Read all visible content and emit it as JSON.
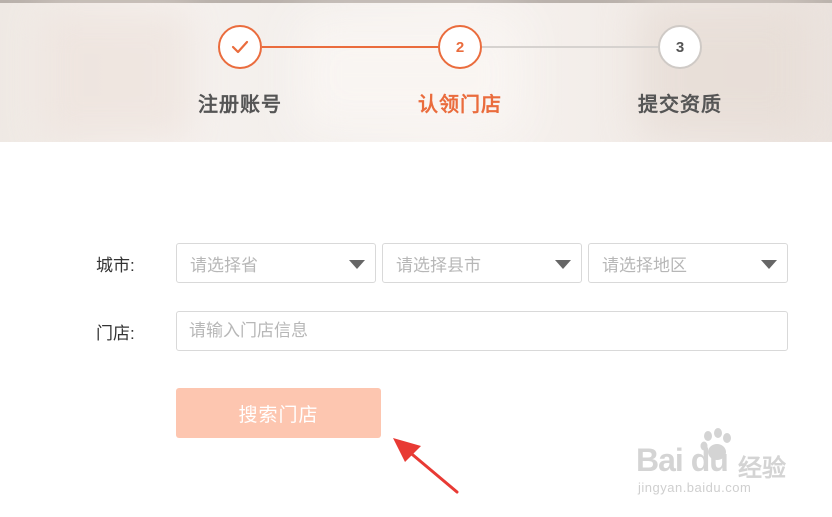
{
  "steps": [
    {
      "number": "",
      "label": "注册账号",
      "state": "done"
    },
    {
      "number": "2",
      "label": "认领门店",
      "state": "active"
    },
    {
      "number": "3",
      "label": "提交资质",
      "state": "pending"
    }
  ],
  "form": {
    "city_label": "城市:",
    "province_placeholder": "请选择省",
    "city_placeholder": "请选择县市",
    "district_placeholder": "请选择地区",
    "store_label": "门店:",
    "store_placeholder": "请输入门店信息",
    "search_label": "搜索门店"
  },
  "watermark": {
    "logo": "Bai du",
    "suffix": "经验",
    "url": "jingyan.baidu.com"
  },
  "colors": {
    "accent": "#ea6c3d",
    "button": "#fdc6b0",
    "pending": "#cfcac6",
    "arrow": "#e83a34"
  },
  "icons": {
    "step_done": "check-icon",
    "select_caret": "caret-down-icon",
    "annotation": "red-arrow-icon"
  }
}
